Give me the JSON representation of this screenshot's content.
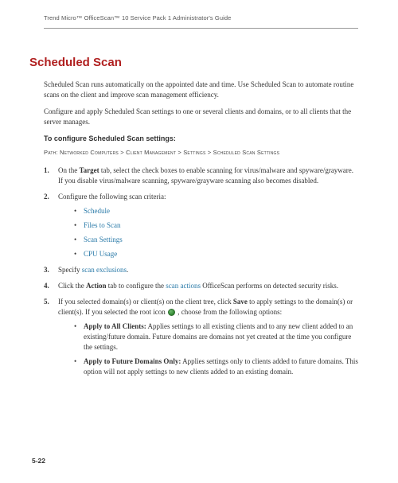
{
  "header": "Trend Micro™ OfficeScan™ 10 Service Pack 1 Administrator's Guide",
  "title": "Scheduled Scan",
  "intro1": "Scheduled Scan runs automatically on the appointed date and time. Use Scheduled Scan to automate routine scans on the client and improve scan management efficiency.",
  "intro2": "Configure and apply Scheduled Scan settings to one or several clients and domains, or to all clients that the server manages.",
  "configHeading": "To configure Scheduled Scan settings:",
  "path": "Path: Networked Computers > Client Management > Settings > Scheduled Scan Settings",
  "steps": {
    "s1a": "On the ",
    "s1tab": "Target",
    "s1b": " tab, select the check boxes to enable scanning for virus/malware and spyware/grayware. If you disable virus/malware scanning, spyware/grayware scanning also becomes disabled.",
    "s2": "Configure the following scan criteria:",
    "criteria": [
      "Schedule",
      "Files to Scan",
      "Scan Settings",
      "CPU Usage"
    ],
    "s3a": "Specify ",
    "s3link": "scan exclusions",
    "s3b": ".",
    "s4a": "Click the ",
    "s4tab": "Action",
    "s4b": " tab to configure the ",
    "s4link": "scan actions",
    "s4c": " OfficeScan performs on detected security risks.",
    "s5a": "If you selected domain(s) or client(s) on the client tree, click ",
    "s5save": "Save",
    "s5b": " to apply settings to the domain(s) or client(s). If you selected the root icon ",
    "s5c": " , choose from the following options:",
    "opt1title": "Apply to All Clients:",
    "opt1body": " Applies settings to all existing clients and to any new client added to an existing/future domain. Future domains are domains not yet created at the time you configure the settings.",
    "opt2title": "Apply to Future Domains Only:",
    "opt2body": " Applies settings only to clients added to future domains. This option will not apply settings to new clients added to an existing domain."
  },
  "pageNum": "5-22"
}
